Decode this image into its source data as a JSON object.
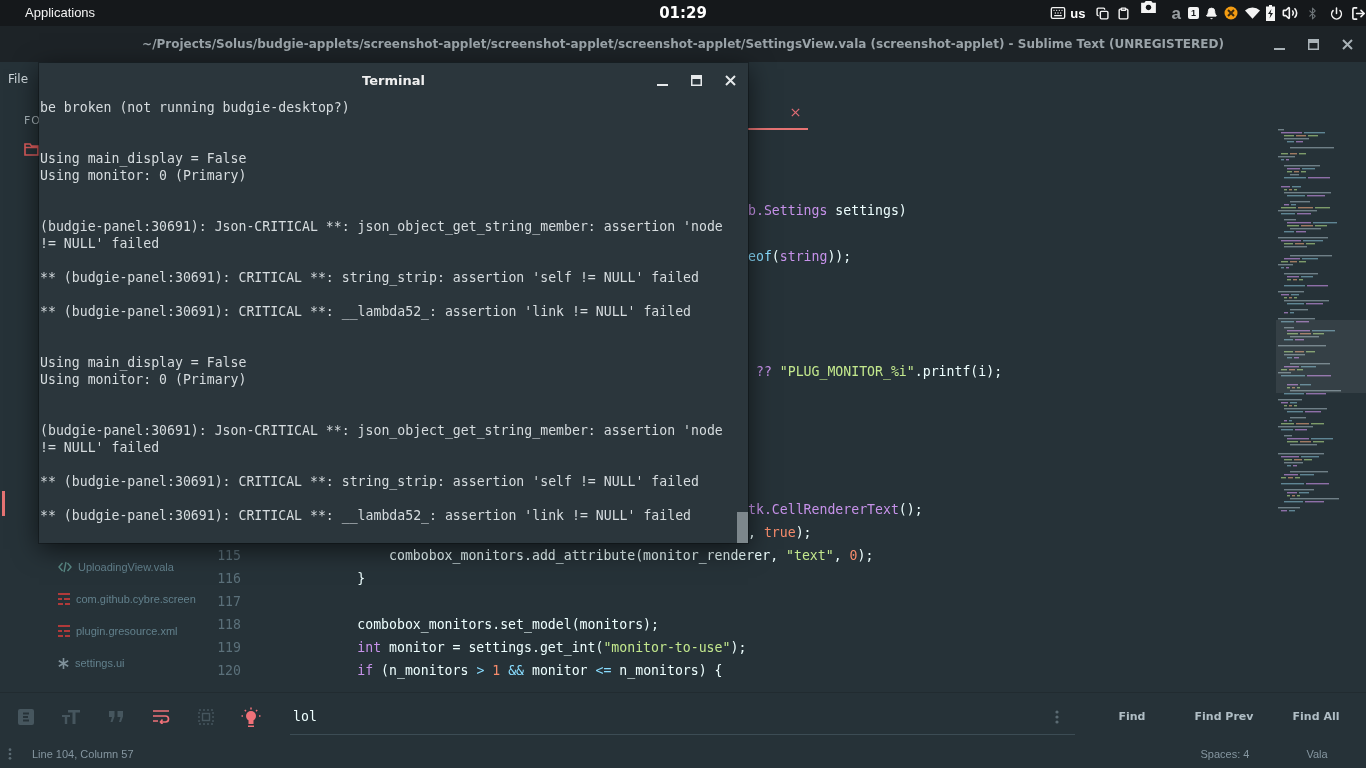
{
  "top_panel": {
    "menu_label": "Applications",
    "clock": "01:29",
    "keyboard_layout": "us",
    "indicator": "a",
    "notification_count": "1"
  },
  "editor_window": {
    "title": "~/Projects/Solus/budgie-applets/screenshot-applet/screenshot-applet/screenshot-applet/SettingsView.vala (screenshot-applet) - Sublime Text (UNREGISTERED)",
    "menu": [
      "File"
    ],
    "sidebar": {
      "heading": "FO",
      "files": [
        {
          "selected": true
        },
        {
          "label": "UploadingView.vala",
          "kind": "code",
          "selected": false
        },
        {
          "label": "com.github.cybre.screen",
          "kind": "data",
          "selected": false
        },
        {
          "label": "plugin.gresource.xml",
          "kind": "data",
          "selected": false
        },
        {
          "label": "settings.ui",
          "kind": "ui",
          "selected": false
        }
      ]
    },
    "tabs": [
      {
        "selected": true
      }
    ],
    "code_lines": [
      {
        "kind": "cut",
        "tokens": [
          {
            "text": "b.Settings",
            "kind": "type"
          },
          {
            "text": " settings)",
            "kind": "plain"
          }
        ]
      },
      {
        "kind": "cut",
        "tokens": [
          {
            "text": "eof",
            "kind": "operator"
          },
          {
            "text": "(",
            "kind": "plain"
          },
          {
            "text": "string",
            "kind": "type"
          },
          {
            "text": "));",
            "kind": "plain"
          }
        ]
      },
      {
        "kind": "cut",
        "tokens": [
          {
            "text": " ?? ",
            "kind": "keyword"
          },
          {
            "text": "\"PLUG_MONITOR_%i\"",
            "kind": "string"
          },
          {
            "text": ".printf(i);",
            "kind": "plain"
          }
        ]
      },
      {
        "kind": "cut",
        "tokens": [
          {
            "text": "tk.CellRendererText",
            "kind": "type"
          },
          {
            "text": "();",
            "kind": "plain"
          }
        ]
      },
      {
        "kind": "cut",
        "tokens": [
          {
            "text": ", ",
            "kind": "plain"
          },
          {
            "text": "true",
            "kind": "number"
          },
          {
            "text": ");",
            "kind": "plain"
          }
        ]
      },
      {
        "kind": "full",
        "number": "115",
        "tokens": [
          {
            "text": "                combobox_monitors.add_attribute(monitor_renderer, ",
            "kind": "plain"
          },
          {
            "text": "\"text\"",
            "kind": "string"
          },
          {
            "text": ", ",
            "kind": "plain"
          },
          {
            "text": "0",
            "kind": "number"
          },
          {
            "text": ");",
            "kind": "plain"
          }
        ]
      },
      {
        "kind": "full",
        "number": "116",
        "tokens": [
          {
            "text": "            }",
            "kind": "plain"
          }
        ]
      },
      {
        "kind": "full",
        "number": "117"
      },
      {
        "kind": "full",
        "number": "118",
        "tokens": [
          {
            "text": "            combobox_monitors.set_model(monitors);",
            "kind": "plain"
          }
        ]
      },
      {
        "kind": "full",
        "number": "119",
        "tokens": [
          {
            "text": "            int",
            "kind": "keyword"
          },
          {
            "text": " monitor = settings.get_int(",
            "kind": "plain"
          },
          {
            "text": "\"monitor-to-use\"",
            "kind": "string"
          },
          {
            "text": ");",
            "kind": "plain"
          }
        ]
      },
      {
        "kind": "full",
        "number": "120",
        "tokens": [
          {
            "text": "            if",
            "kind": "keyword"
          },
          {
            "text": " (n_monitors ",
            "kind": "plain"
          },
          {
            "text": "> ",
            "kind": "operator"
          },
          {
            "text": "1 ",
            "kind": "number"
          },
          {
            "text": "&&",
            "kind": "operator"
          },
          {
            "text": " monitor ",
            "kind": "plain"
          },
          {
            "text": "<=",
            "kind": "operator"
          },
          {
            "text": " n_monitors) {",
            "kind": "plain"
          }
        ]
      }
    ],
    "find_panel": {
      "toggles": [
        {
          "kind": "regex",
          "on": false
        },
        {
          "kind": "case",
          "on": false
        },
        {
          "kind": "whole_word",
          "on": false
        },
        {
          "kind": "wrap",
          "on": true
        },
        {
          "kind": "in_selection",
          "on": false
        },
        {
          "kind": "highlight",
          "on": true
        }
      ],
      "field": {
        "value": "lol"
      },
      "buttons": [
        "Find",
        "Find Prev",
        "Find All"
      ]
    },
    "status_bar": {
      "position": "Line 104, Column 57",
      "indentation": "Spaces: 4",
      "syntax": "Vala"
    }
  },
  "terminal": {
    "title": "Terminal",
    "output": "be broken (not running budgie-desktop?)\n\n\nUsing main_display = False\nUsing monitor: 0 (Primary)\n\n\n(budgie-panel:30691): Json-CRITICAL **: json_object_get_string_member: assertion 'node\n!= NULL' failed\n\n** (budgie-panel:30691): CRITICAL **: string_strip: assertion 'self != NULL' failed\n\n** (budgie-panel:30691): CRITICAL **: __lambda52_: assertion 'link != NULL' failed\n\n\nUsing main_display = False\nUsing monitor: 0 (Primary)\n\n\n(budgie-panel:30691): Json-CRITICAL **: json_object_get_string_member: assertion 'node\n!= NULL' failed\n\n** (budgie-panel:30691): CRITICAL **: string_strip: assertion 'self != NULL' failed\n\n** (budgie-panel:30691): CRITICAL **: __lambda52_: assertion 'link != NULL' failed"
  }
}
